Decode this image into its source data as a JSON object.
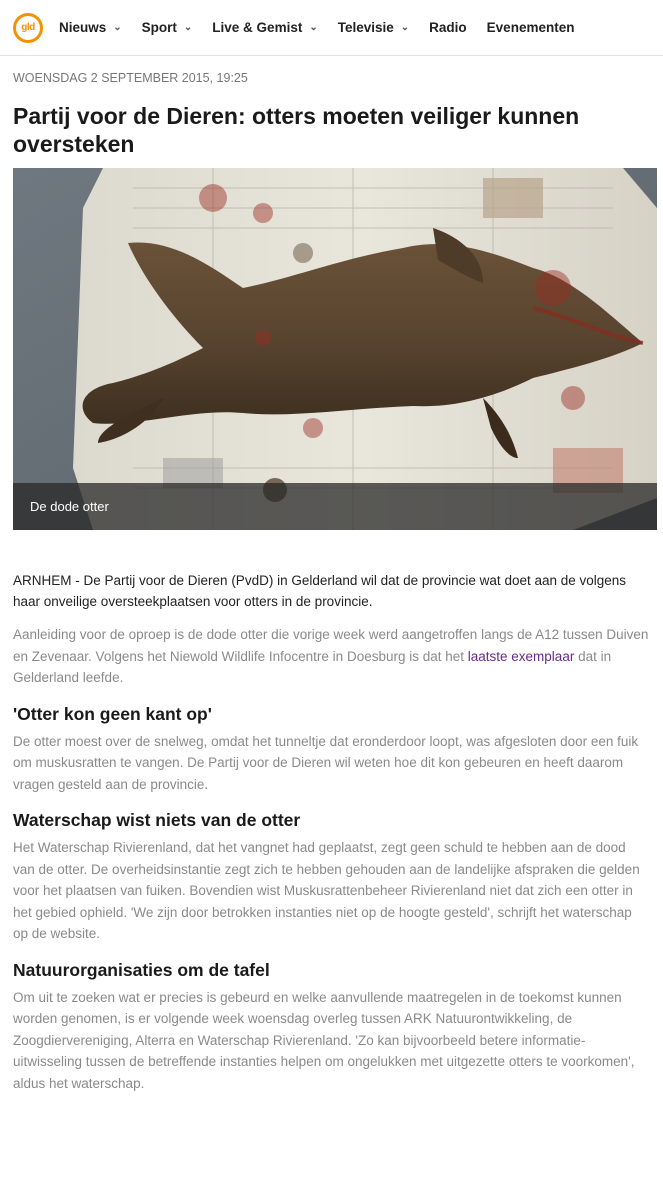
{
  "nav": {
    "logo_text": "gld",
    "items": [
      {
        "label": "Nieuws",
        "dropdown": true
      },
      {
        "label": "Sport",
        "dropdown": true
      },
      {
        "label": "Live & Gemist",
        "dropdown": true
      },
      {
        "label": "Televisie",
        "dropdown": true
      },
      {
        "label": "Radio",
        "dropdown": false
      },
      {
        "label": "Evenementen",
        "dropdown": false
      }
    ],
    "caret": "⌄"
  },
  "article": {
    "date": "WOENSDAG 2 SEPTEMBER 2015, 19:25",
    "title": "Partij voor de Dieren: otters moeten veiliger kunnen oversteken",
    "image_caption": "De dode otter",
    "lead": "ARNHEM - De Partij voor de Dieren (PvdD) in Gelderland wil dat de provincie wat doet aan de volgens haar onveilige oversteekplaatsen voor otters in de provincie.",
    "p1_before": "Aanleiding voor de oproep is de dode otter die vorige week werd aangetroffen langs de A12 tussen Duiven en Zevenaar. Volgens het Niewold Wildlife Infocentre in Doesburg is dat het ",
    "p1_link": "laatste exemplaar",
    "p1_after": " dat in Gelderland leefde.",
    "h2_1": "'Otter kon geen kant op'",
    "p2": "De otter moest over de snelweg, omdat het tunneltje dat eronderdoor loopt, was afgesloten door een fuik om muskusratten te vangen. De Partij voor de Dieren wil weten hoe dit kon gebeuren en heeft daarom vragen gesteld aan de provincie.",
    "h2_2": "Waterschap wist niets van de otter",
    "p3": "Het Waterschap Rivierenland, dat het vangnet had geplaatst, zegt geen schuld te hebben aan de dood van de otter. De overheidsinstantie zegt zich te hebben gehouden aan de landelijke afspraken die gelden voor het plaatsen van fuiken. Bovendien wist Muskusrattenbeheer Rivierenland niet dat zich een otter in het gebied ophield. 'We zijn door betrokken instanties niet op de hoogte gesteld', schrijft het waterschap op de website.",
    "h2_3": "Natuurorganisaties om de tafel",
    "p4": "Om uit te zoeken wat er precies is gebeurd en welke aanvullende maatregelen in de toekomst kunnen worden genomen, is er volgende week woensdag overleg tussen ARK Natuurontwikkeling, de Zoogdiervereniging, Alterra en Waterschap Rivierenland. 'Zo kan bijvoorbeeld betere informatie-uitwisseling tussen de betreffende instanties helpen om ongelukken met uitgezette otters te voorkomen', aldus het waterschap."
  }
}
